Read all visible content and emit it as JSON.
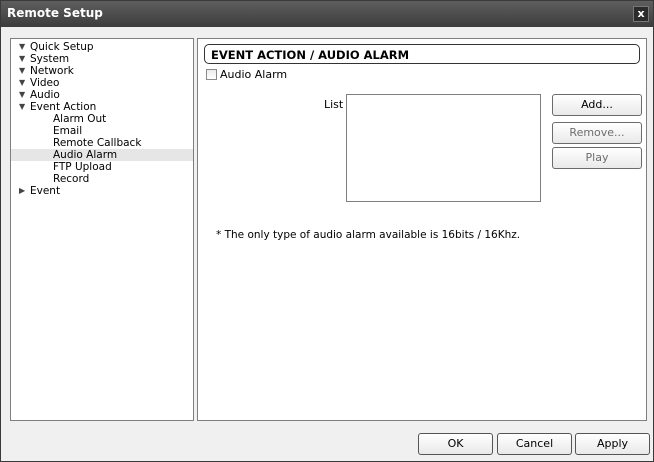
{
  "window": {
    "title": "Remote Setup",
    "close_glyph": "x"
  },
  "tree": {
    "items": [
      {
        "label": "Quick Setup",
        "level": 0,
        "arrow": "▼"
      },
      {
        "label": "System",
        "level": 0,
        "arrow": "▼"
      },
      {
        "label": "Network",
        "level": 0,
        "arrow": "▼"
      },
      {
        "label": "Video",
        "level": 0,
        "arrow": "▼"
      },
      {
        "label": "Audio",
        "level": 0,
        "arrow": "▼"
      },
      {
        "label": "Event Action",
        "level": 0,
        "arrow": "▼"
      },
      {
        "label": "Alarm Out",
        "level": 1
      },
      {
        "label": "Email",
        "level": 1
      },
      {
        "label": "Remote Callback",
        "level": 1
      },
      {
        "label": "Audio Alarm",
        "level": 1,
        "selected": true
      },
      {
        "label": "FTP Upload",
        "level": 1
      },
      {
        "label": "Record",
        "level": 1
      },
      {
        "label": "Event",
        "level": 0,
        "arrow": "▶"
      }
    ]
  },
  "main": {
    "header": "EVENT ACTION / AUDIO ALARM",
    "audio_alarm_checkbox_label": "Audio Alarm",
    "audio_alarm_checked": false,
    "list_label": "List",
    "list_items": [],
    "buttons": {
      "add": "Add...",
      "remove": "Remove...",
      "play": "Play"
    },
    "note": "* The only type of audio alarm available is 16bits / 16Khz."
  },
  "footer": {
    "ok": "OK",
    "cancel": "Cancel",
    "apply": "Apply"
  }
}
